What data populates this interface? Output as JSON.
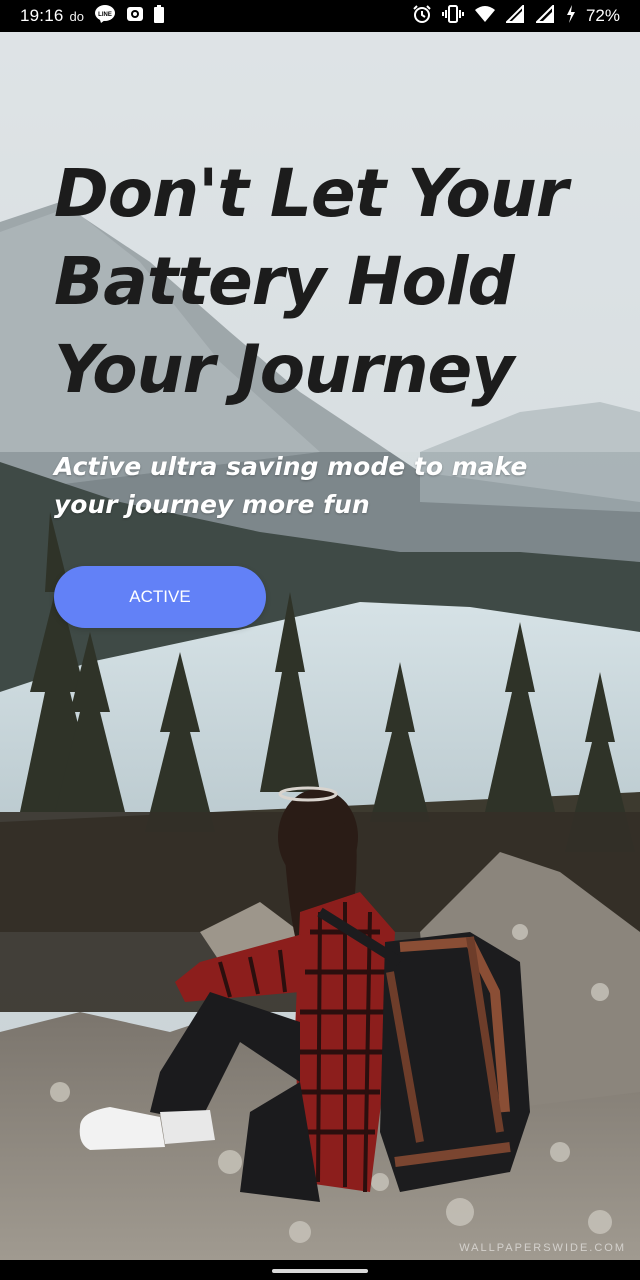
{
  "status_bar": {
    "time": "19:16",
    "carrier_label": "do",
    "battery_percent": "72%",
    "icons": [
      "line-app-icon",
      "photo-app-icon",
      "battery-saver-icon",
      "alarm-icon",
      "vibrate-icon",
      "wifi-icon",
      "signal-icon",
      "signal-icon-2",
      "charging-icon"
    ]
  },
  "hero": {
    "headline_line1": "Don't Let Your",
    "headline_line2": "Battery Hold",
    "headline_line3": "Your Journey",
    "subtitle_line1": "Active ultra saving mode to make",
    "subtitle_line2": "your journey more fun",
    "cta_label": "ACTIVE"
  },
  "colors": {
    "accent": "#6281f7",
    "headline": "#1c1c1c",
    "subtitle": "#ffffff"
  },
  "watermark": "WALLPAPERSWIDE.COM"
}
